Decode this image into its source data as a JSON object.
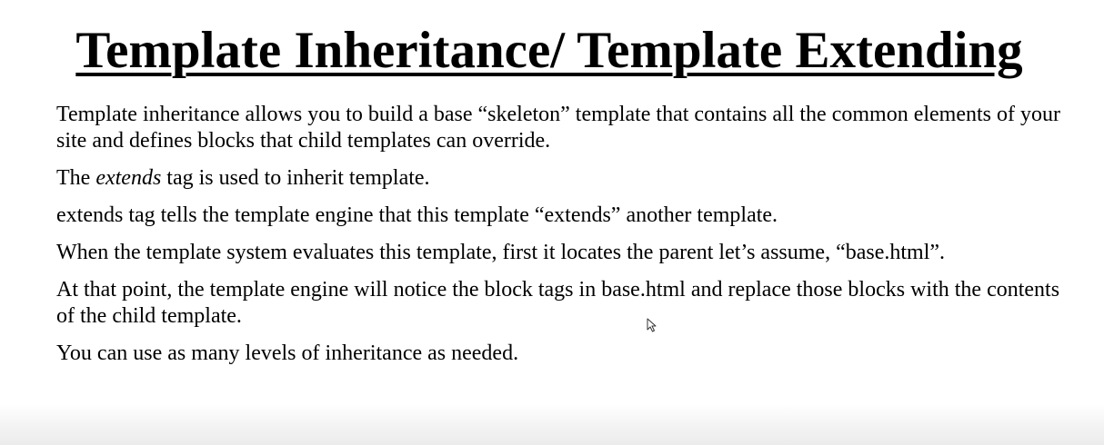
{
  "slide": {
    "title": "Template Inheritance/ Template Extending",
    "paragraphs": [
      {
        "text": "Template inheritance allows you to build a base “skeleton” template that contains all the common elements of your site and defines blocks that child templates can override."
      },
      {
        "prefix": "The ",
        "emphasis": "extends",
        "suffix": " tag is used to inherit template."
      },
      {
        "text": "extends tag tells the template engine that this template “extends” another template."
      },
      {
        "text": "When the template system evaluates this template, first it locates the parent let’s assume, “base.html”."
      },
      {
        "text": "At that point, the template engine will notice the block tags in base.html and replace those blocks with the contents of the child template."
      },
      {
        "text": "You can use as many levels of inheritance as needed."
      }
    ]
  },
  "icons": {
    "cursor": "mouse-pointer-icon"
  }
}
